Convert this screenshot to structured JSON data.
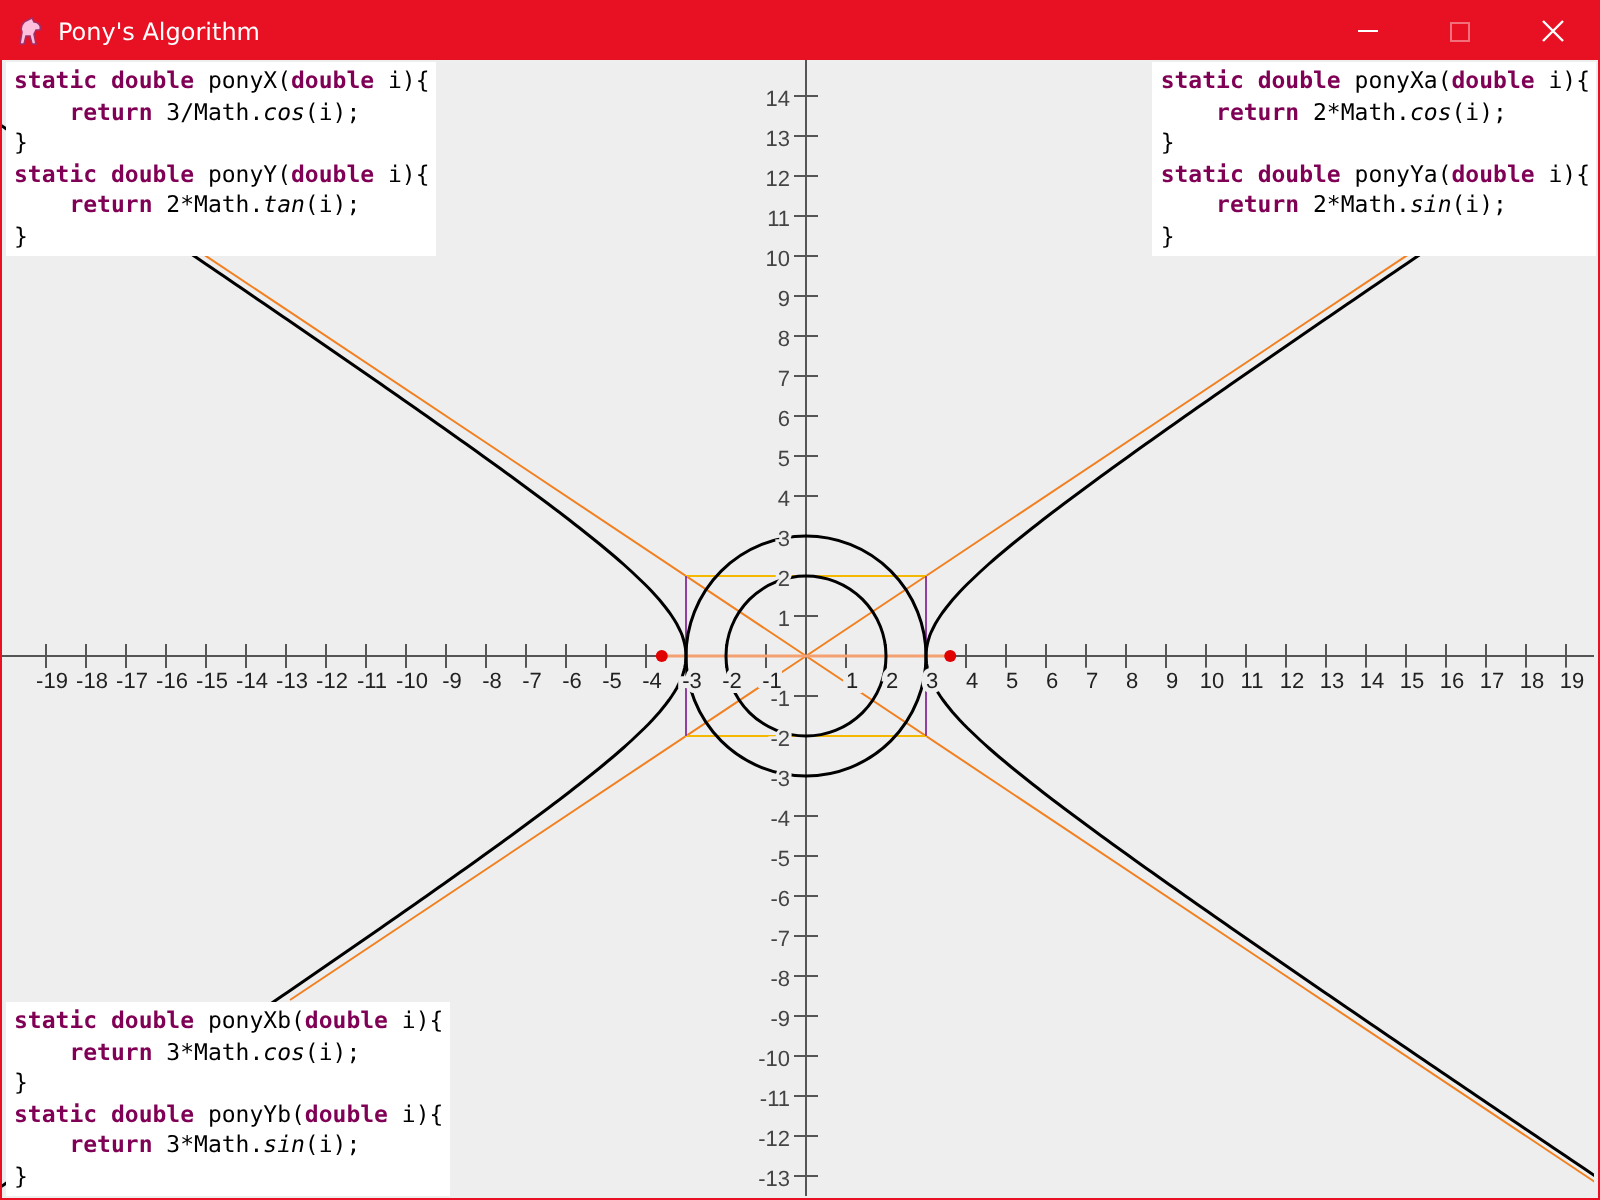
{
  "window": {
    "title": "Pony's Algorithm",
    "controls": [
      {
        "kind": "minimize",
        "disabled": false
      },
      {
        "kind": "maximize",
        "disabled": true
      },
      {
        "kind": "close",
        "disabled": false
      }
    ]
  },
  "code_blocks": [
    {
      "lines": [
        "**static** **double** ponyX(**double** i){",
        "    **return** 3/Math.*cos*(i);",
        "}",
        "**static** **double** ponyY(**double** i){",
        "    **return** 2*Math.*tan*(i);",
        "}"
      ]
    },
    {
      "lines": [
        "**static** **double** ponyXa(**double** i){",
        "    **return** 2*Math.*cos*(i);",
        "}",
        "**static** **double** ponyYa(**double** i){",
        "    **return** 2*Math.*sin*(i);",
        "}"
      ]
    },
    {
      "lines": [
        "**static** **double** ponyXb(**double** i){",
        "    **return** 3*Math.*cos*(i);",
        "}",
        "**static** **double** ponyYb(**double** i){",
        "    **return** 3*Math.*sin*(i);",
        "}"
      ]
    }
  ],
  "x_axis": {
    "ticks": [
      "-19",
      "-18",
      "-17",
      "-16",
      "-15",
      "-14",
      "-13",
      "-12",
      "-11",
      "-10",
      "-9",
      "-8",
      "-7",
      "-6",
      "-5",
      "-4",
      "-3",
      "-2",
      "-1",
      "1",
      "2",
      "3",
      "4",
      "5",
      "6",
      "7",
      "8",
      "9",
      "10",
      "11",
      "12",
      "13",
      "14",
      "15",
      "16",
      "17",
      "18",
      "19"
    ]
  },
  "y_axis": {
    "ticks": [
      "14",
      "13",
      "12",
      "11",
      "10",
      "9",
      "8",
      "7",
      "6",
      "5",
      "4",
      "3",
      "2",
      "1",
      "-1",
      "-2",
      "-3",
      "-4",
      "-5",
      "-6",
      "-7",
      "-8",
      "-9",
      "-10",
      "-11",
      "-12",
      "-13"
    ]
  }
}
